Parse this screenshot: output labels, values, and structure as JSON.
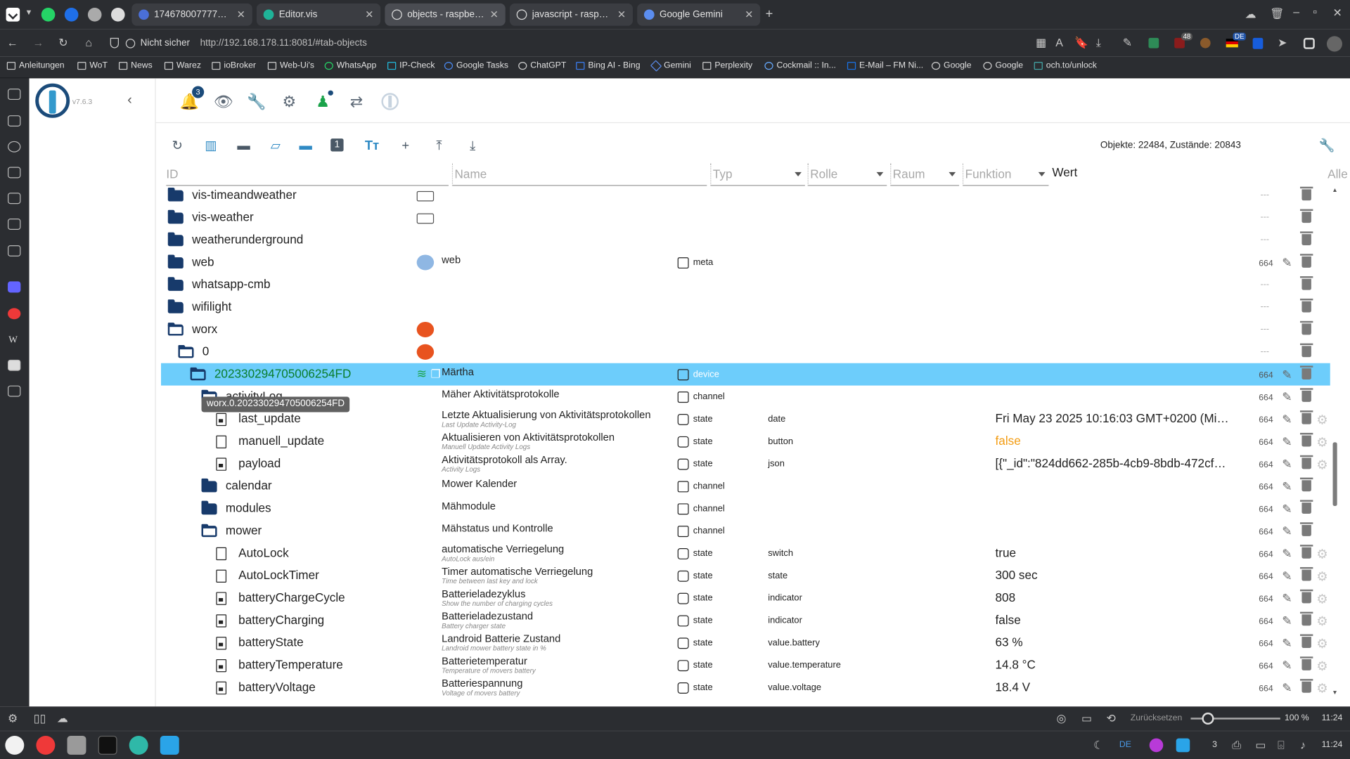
{
  "browser": {
    "tabs": [
      {
        "title": "1746780077771-83...",
        "fav_color": "#4a6fd8",
        "active": false
      },
      {
        "title": "Editor.vis",
        "fav_color": "#1fb398",
        "active": false
      },
      {
        "title": "objects - raspberrypi",
        "fav_color": "#dcdcdc",
        "active": true
      },
      {
        "title": "javascript - raspber...",
        "fav_color": "#dcdcdc",
        "active": false
      },
      {
        "title": "Google Gemini",
        "fav_color": "#5b8def",
        "active": false
      }
    ],
    "security_label": "Nicht sicher",
    "url": "http://192.168.178.11:8081/#tab-objects",
    "badges": {
      "ublock": "48",
      "lang": "DE"
    },
    "bookmarks": [
      {
        "label": "Anleitungen"
      },
      {
        "label": "WoT"
      },
      {
        "label": "News"
      },
      {
        "label": "Warez"
      },
      {
        "label": "ioBroker"
      },
      {
        "label": "Web-Ui's"
      },
      {
        "label": "WhatsApp"
      },
      {
        "label": "IP-Check"
      },
      {
        "label": "Google Tasks"
      },
      {
        "label": "ChatGPT"
      },
      {
        "label": "Bing AI - Bing"
      },
      {
        "label": "Gemini"
      },
      {
        "label": "Perplexity"
      },
      {
        "label": "Cockmail :: In..."
      },
      {
        "label": "E-Mail – FM Ni..."
      },
      {
        "label": "Google"
      },
      {
        "label": "Google"
      },
      {
        "label": "och.to/unlock"
      }
    ]
  },
  "app": {
    "version": "v7.6.3",
    "notification_count": "3",
    "summary": "Objekte: 22484, Zustände: 20843",
    "accent": "#3399cc",
    "selected_row_color": "#6dcdfb"
  },
  "columns": {
    "id": "ID",
    "name": "Name",
    "type": "Typ",
    "role": "Rolle",
    "room": "Raum",
    "function": "Funktion",
    "value": "Wert",
    "all": "Alle"
  },
  "tooltip": "worx.0.202330294705006254FD",
  "rows": [
    {
      "id": "vis-timeandweather",
      "kind": "folder",
      "level": 0,
      "acl": "---"
    },
    {
      "id": "vis-weather",
      "kind": "folder",
      "level": 0,
      "acl": "---"
    },
    {
      "id": "weatherunderground",
      "kind": "folder",
      "level": 0,
      "acl": "---"
    },
    {
      "id": "web",
      "kind": "folder",
      "level": 0,
      "name": "web",
      "type": "meta",
      "acl": "664"
    },
    {
      "id": "whatsapp-cmb",
      "kind": "folder",
      "level": 0,
      "acl": "---"
    },
    {
      "id": "wifilight",
      "kind": "folder",
      "level": 0,
      "acl": "---"
    },
    {
      "id": "worx",
      "kind": "open",
      "level": 0,
      "acl": "---"
    },
    {
      "id": "0",
      "kind": "open",
      "level": 1,
      "acl": "---"
    },
    {
      "id": "202330294705006254FD",
      "kind": "open",
      "level": 2,
      "name": "Märtha",
      "type": "device",
      "acl": "664",
      "selected": true
    },
    {
      "id": "activityLog",
      "kind": "open",
      "level": 3,
      "name": "Mäher Aktivitätsprotokolle",
      "type": "channel",
      "acl": "664"
    },
    {
      "id": "last_update",
      "kind": "lockfile",
      "level": 4,
      "name": "Letzte Aktualisierung von Aktivitätsprotokollen",
      "desc": "Last Update Activity-Log",
      "type": "state",
      "role": "date",
      "value": "Fri May 23 2025 10:16:03 GMT+0200 (Mitte...",
      "acl": "664"
    },
    {
      "id": "manuell_update",
      "kind": "file",
      "level": 4,
      "name": "Aktualisieren von Aktivitätsprotokollen",
      "desc": "Manuell Update Activity Logs",
      "type": "state",
      "role": "button",
      "value": "false",
      "value_orange": true,
      "acl": "664"
    },
    {
      "id": "payload",
      "kind": "lockfile",
      "level": 4,
      "name": "Aktivitätsprotokoll als Array.",
      "desc": "Activity Logs",
      "type": "state",
      "role": "json",
      "value": "[{\"_id\":\"824dd662-285b-4cb9-8bdb-472cfc1...",
      "acl": "664"
    },
    {
      "id": "calendar",
      "kind": "folder",
      "level": 3,
      "name": "Mower Kalender",
      "type": "channel",
      "acl": "664"
    },
    {
      "id": "modules",
      "kind": "folder",
      "level": 3,
      "name": "Mähmodule",
      "type": "channel",
      "acl": "664"
    },
    {
      "id": "mower",
      "kind": "open",
      "level": 3,
      "name": "Mähstatus und Kontrolle",
      "type": "channel",
      "acl": "664"
    },
    {
      "id": "AutoLock",
      "kind": "file",
      "level": 4,
      "name": "automatische Verriegelung",
      "desc": "AutoLock aus/ein",
      "type": "state",
      "role": "switch",
      "value": "true",
      "acl": "664"
    },
    {
      "id": "AutoLockTimer",
      "kind": "file",
      "level": 4,
      "name": "Timer automatische Verriegelung",
      "desc": "Time between last key and lock",
      "type": "state",
      "role": "state",
      "value": "300 sec",
      "acl": "664"
    },
    {
      "id": "batteryChargeCycle",
      "kind": "lockfile",
      "level": 4,
      "name": "Batterieladezyklus",
      "desc": "Show the number of charging cycles",
      "type": "state",
      "role": "indicator",
      "value": "808",
      "acl": "664"
    },
    {
      "id": "batteryCharging",
      "kind": "lockfile",
      "level": 4,
      "name": "Batterieladezustand",
      "desc": "Battery charger state",
      "type": "state",
      "role": "indicator",
      "value": "false",
      "acl": "664"
    },
    {
      "id": "batteryState",
      "kind": "lockfile",
      "level": 4,
      "name": "Landroid Batterie Zustand",
      "desc": "Landroid mower battery state in %",
      "type": "state",
      "role": "value.battery",
      "value": "63 %",
      "acl": "664"
    },
    {
      "id": "batteryTemperature",
      "kind": "lockfile",
      "level": 4,
      "name": "Batterietemperatur",
      "desc": "Temperature of movers battery",
      "type": "state",
      "role": "value.temperature",
      "value": "14.8 °C",
      "acl": "664"
    },
    {
      "id": "batteryVoltage",
      "kind": "lockfile",
      "level": 4,
      "name": "Batteriespannung",
      "desc": "Voltage of movers battery",
      "type": "state",
      "role": "value.voltage",
      "value": "18.4 V",
      "acl": "664"
    }
  ],
  "statusbar": {
    "reset_label": "Zurücksetzen",
    "zoom": "100 %",
    "time": "11:24"
  },
  "taskbar": {
    "lang": "DE",
    "badge": "3",
    "time": "11:24"
  }
}
